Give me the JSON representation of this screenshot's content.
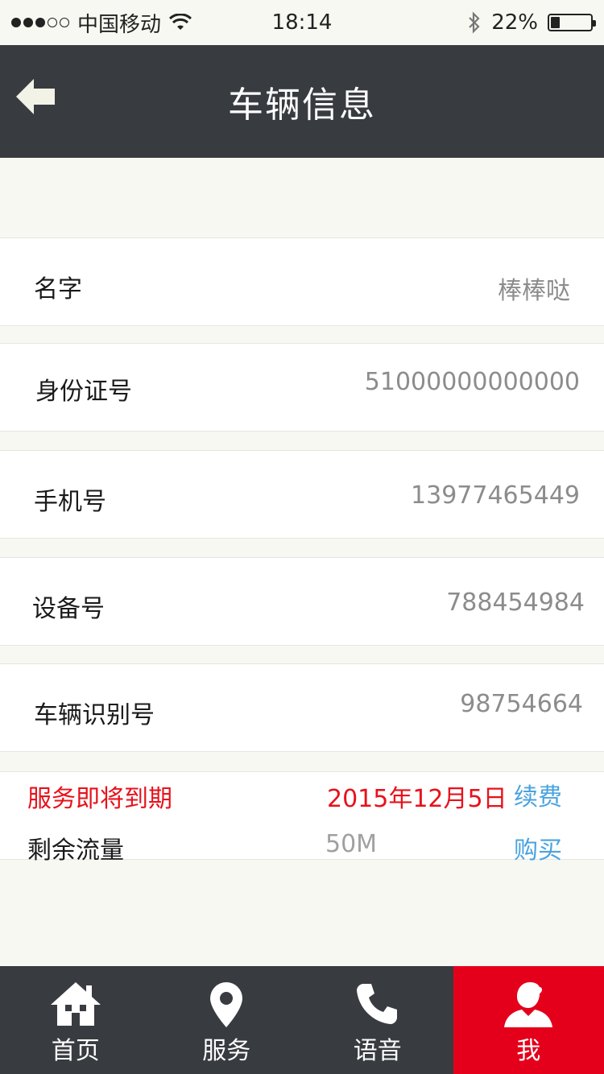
{
  "status_bar": {
    "carrier": "中国移动",
    "time": "18:14",
    "battery": "22%",
    "battery_level": 0.22
  },
  "nav": {
    "title": "车辆信息"
  },
  "rows": [
    {
      "label": "名字",
      "value": "棒棒哒"
    },
    {
      "label": "身份证号",
      "value": "51000000000000"
    },
    {
      "label": "手机号",
      "value": "13977465449"
    },
    {
      "label": "设备号",
      "value": "788454984"
    },
    {
      "label": "车辆识别号",
      "value": "98754664"
    }
  ],
  "service": {
    "expire_label": "服务即将到期",
    "expire_date": "2015年12月5日",
    "renew_label": "续费",
    "traffic_label": "剩余流量",
    "traffic_value": "50M",
    "buy_label": "购买"
  },
  "tabs": [
    {
      "label": "首页",
      "icon": "home-icon"
    },
    {
      "label": "服务",
      "icon": "location-pin-icon"
    },
    {
      "label": "语音",
      "icon": "phone-icon"
    },
    {
      "label": "我",
      "icon": "user-icon",
      "active": true
    }
  ],
  "colors": {
    "nav_bg": "#383b40",
    "active_tab": "#e4001b",
    "alert_red": "#e8111b",
    "link_blue": "#4aa3df"
  }
}
